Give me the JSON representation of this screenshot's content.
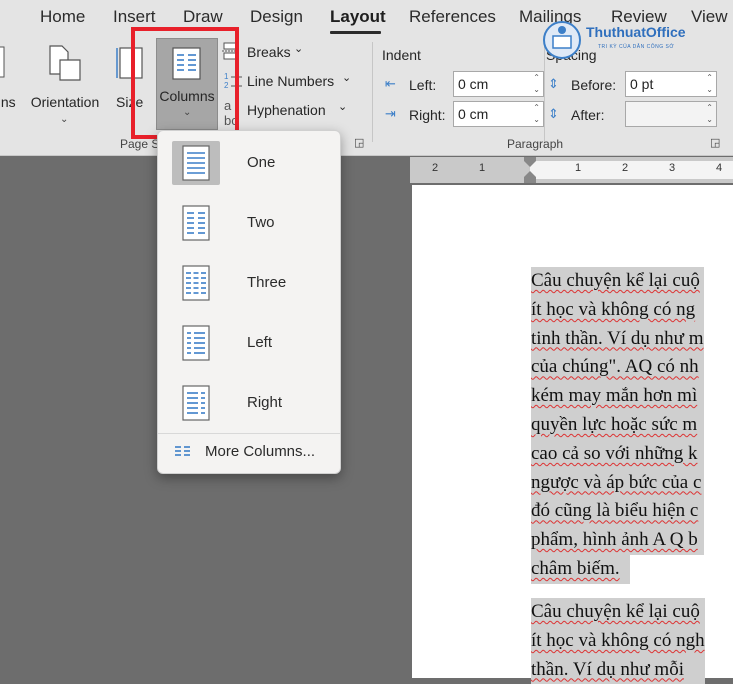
{
  "tabs": [
    "Home",
    "Insert",
    "Draw",
    "Design",
    "Layout",
    "References",
    "Mailings",
    "Review",
    "View"
  ],
  "ribbon": {
    "margins_label": "gins",
    "orientation_label": "Orientation",
    "size_label": "Size",
    "columns_label": "Columns",
    "breaks_label": "Breaks",
    "line_numbers_label": "Line Numbers",
    "hyphenation_label": "Hyphenation",
    "page_setup_label": "Page S",
    "hidden_fragment": "a",
    "hidden_fragment2": "bc",
    "indent_label": "Indent",
    "spacing_label": "Spacing",
    "left_label": "Left:",
    "right_label": "Right:",
    "left_value": "0 cm",
    "right_value": "0 cm",
    "before_label": "Before:",
    "after_label": "After:",
    "before_value": "0 pt",
    "after_value": "",
    "paragraph_label": "Paragraph"
  },
  "logo": {
    "name": "ThuthuatOffice",
    "tagline": "TRI KỲ CỦA DÂN CÔNG SỞ"
  },
  "dropdown": {
    "items": [
      "One",
      "Two",
      "Three",
      "Left",
      "Right"
    ],
    "selected": "One",
    "more": "More Columns..."
  },
  "ruler": {
    "numbers": [
      "2",
      "1",
      "1",
      "2",
      "3",
      "4"
    ]
  },
  "document": {
    "para1": [
      "Câu chuyện kể lại cuộ",
      "ít học và không có ng",
      "tinh thần. Ví dụ như m",
      "của chúng\". AQ có nh",
      "kém may mắn hơn mì",
      "quyền lực hoặc sức m",
      "cao cả so với những k",
      "ngược và áp bức của c",
      "đó cũng là biểu hiện c",
      "phẩm, hình ảnh A Q b",
      "châm biếm."
    ],
    "para2": [
      "Câu chuyện kể lại cuộ",
      "ít học và không có ngh",
      "thần. Ví dụ như mỗi"
    ]
  }
}
